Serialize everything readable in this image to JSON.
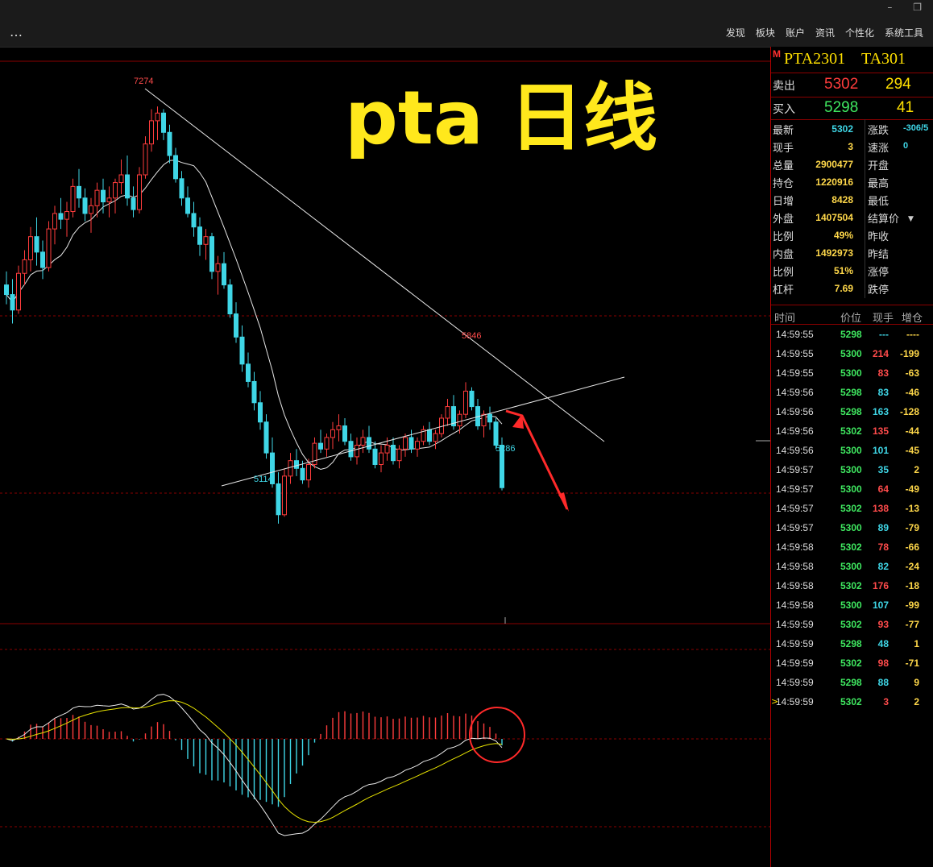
{
  "window": {
    "minimize_glyph": "–",
    "restore_glyph": "❐"
  },
  "toolbar": {
    "more_label": "…",
    "menu": [
      "发现",
      "板块",
      "账户",
      "资讯",
      "个性化",
      "系统工具"
    ]
  },
  "overlay_title": "pta 日线",
  "colors": {
    "up": "#ff3c3c",
    "down": "#3fd6e6",
    "ma": "#e6e6e6",
    "bg": "#000000",
    "grid": "#8a0000",
    "yellow_title": "#ffe81c",
    "arrow": "#ff2a2a"
  },
  "chart_data": {
    "type": "candlestick",
    "annotations": [
      {
        "text": "7274",
        "kind": "high",
        "color": "#ff4b4b"
      },
      {
        "text": "5846",
        "kind": "high",
        "color": "#ff4b4b"
      },
      {
        "text": "5114",
        "kind": "low",
        "color": "#3fd6e6"
      },
      {
        "text": "5286",
        "kind": "low",
        "color": "#3fd6e6"
      }
    ],
    "price_range": [
      4600,
      7500
    ],
    "candles": [
      [
        6350,
        6420,
        6250,
        6300
      ],
      [
        6300,
        6380,
        6150,
        6220
      ],
      [
        6220,
        6450,
        6200,
        6410
      ],
      [
        6410,
        6530,
        6350,
        6480
      ],
      [
        6480,
        6650,
        6420,
        6600
      ],
      [
        6600,
        6700,
        6450,
        6520
      ],
      [
        6520,
        6580,
        6380,
        6440
      ],
      [
        6440,
        6680,
        6420,
        6640
      ],
      [
        6640,
        6760,
        6560,
        6720
      ],
      [
        6720,
        6800,
        6640,
        6690
      ],
      [
        6690,
        6780,
        6600,
        6730
      ],
      [
        6730,
        6900,
        6700,
        6860
      ],
      [
        6860,
        6950,
        6750,
        6800
      ],
      [
        6800,
        6850,
        6680,
        6720
      ],
      [
        6720,
        6800,
        6620,
        6760
      ],
      [
        6760,
        6880,
        6700,
        6840
      ],
      [
        6840,
        6900,
        6720,
        6780
      ],
      [
        6780,
        6860,
        6700,
        6800
      ],
      [
        6800,
        6900,
        6720,
        6880
      ],
      [
        6880,
        7000,
        6820,
        6920
      ],
      [
        6920,
        7020,
        6760,
        6800
      ],
      [
        6800,
        6860,
        6700,
        6740
      ],
      [
        6740,
        6960,
        6720,
        6920
      ],
      [
        6920,
        7120,
        6900,
        7080
      ],
      [
        7080,
        7260,
        7040,
        7200
      ],
      [
        7200,
        7274,
        7100,
        7240
      ],
      [
        7240,
        7260,
        7100,
        7140
      ],
      [
        7140,
        7180,
        6980,
        7020
      ],
      [
        7020,
        7060,
        6880,
        6900
      ],
      [
        6900,
        6940,
        6760,
        6800
      ],
      [
        6800,
        6860,
        6700,
        6720
      ],
      [
        6720,
        6780,
        6600,
        6650
      ],
      [
        6650,
        6700,
        6500,
        6560
      ],
      [
        6560,
        6640,
        6480,
        6600
      ],
      [
        6600,
        6620,
        6380,
        6420
      ],
      [
        6420,
        6500,
        6300,
        6460
      ],
      [
        6460,
        6520,
        6330,
        6350
      ],
      [
        6350,
        6380,
        6180,
        6200
      ],
      [
        6200,
        6260,
        6050,
        6080
      ],
      [
        6080,
        6140,
        5900,
        5940
      ],
      [
        5940,
        6000,
        5820,
        5850
      ],
      [
        5850,
        5900,
        5700,
        5740
      ],
      [
        5740,
        5800,
        5600,
        5640
      ],
      [
        5640,
        5680,
        5450,
        5480
      ],
      [
        5480,
        5560,
        5300,
        5320
      ],
      [
        5320,
        5380,
        5114,
        5160
      ],
      [
        5160,
        5400,
        5150,
        5360
      ],
      [
        5360,
        5480,
        5320,
        5440
      ],
      [
        5440,
        5500,
        5360,
        5400
      ],
      [
        5400,
        5440,
        5320,
        5340
      ],
      [
        5340,
        5450,
        5300,
        5420
      ],
      [
        5420,
        5560,
        5400,
        5530
      ],
      [
        5530,
        5600,
        5480,
        5500
      ],
      [
        5500,
        5580,
        5460,
        5560
      ],
      [
        5560,
        5640,
        5500,
        5600
      ],
      [
        5600,
        5680,
        5540,
        5620
      ],
      [
        5620,
        5660,
        5520,
        5540
      ],
      [
        5540,
        5580,
        5440,
        5460
      ],
      [
        5460,
        5560,
        5420,
        5520
      ],
      [
        5520,
        5600,
        5480,
        5560
      ],
      [
        5560,
        5620,
        5480,
        5500
      ],
      [
        5500,
        5540,
        5400,
        5420
      ],
      [
        5420,
        5520,
        5380,
        5480
      ],
      [
        5480,
        5560,
        5440,
        5520
      ],
      [
        5520,
        5560,
        5420,
        5440
      ],
      [
        5440,
        5520,
        5400,
        5500
      ],
      [
        5500,
        5580,
        5460,
        5560
      ],
      [
        5560,
        5600,
        5480,
        5500
      ],
      [
        5500,
        5560,
        5460,
        5540
      ],
      [
        5540,
        5620,
        5520,
        5600
      ],
      [
        5600,
        5640,
        5520,
        5540
      ],
      [
        5540,
        5600,
        5500,
        5580
      ],
      [
        5580,
        5680,
        5560,
        5660
      ],
      [
        5660,
        5760,
        5620,
        5720
      ],
      [
        5720,
        5780,
        5600,
        5620
      ],
      [
        5620,
        5700,
        5580,
        5680
      ],
      [
        5680,
        5846,
        5660,
        5800
      ],
      [
        5800,
        5820,
        5700,
        5720
      ],
      [
        5720,
        5760,
        5600,
        5620
      ],
      [
        5620,
        5700,
        5560,
        5680
      ],
      [
        5680,
        5720,
        5600,
        5640
      ],
      [
        5640,
        5660,
        5500,
        5520
      ],
      [
        5520,
        5560,
        5286,
        5300
      ]
    ],
    "trendlines": [
      {
        "from": [
          25,
          7274
        ],
        "to": [
          100,
          5300
        ]
      },
      {
        "from": [
          45,
          5030
        ],
        "to": [
          100,
          5580
        ]
      }
    ],
    "macd": {
      "zero": 0,
      "range": [
        -1.0,
        1.0
      ],
      "hist_pos_color": "#ff4b4b",
      "hist_neg_color": "#3fd6e6"
    }
  },
  "panel": {
    "title_mark": "M",
    "symbol": "PTA2301",
    "code": "TA301",
    "ask": {
      "label": "卖出",
      "price": "5302",
      "vol": "294"
    },
    "bid": {
      "label": "买入",
      "price": "5298",
      "vol": "41"
    },
    "stats_left": [
      {
        "k": "最新",
        "v": "5302",
        "c": "#3fd6e6"
      },
      {
        "k": "现手",
        "v": "3",
        "c": "#ffd84a"
      },
      {
        "k": "总量",
        "v": "2900477",
        "c": "#ffd84a"
      },
      {
        "k": "持仓",
        "v": "1220916",
        "c": "#ffd84a"
      },
      {
        "k": "日增",
        "v": "8428",
        "c": "#ffd84a"
      },
      {
        "k": "外盘",
        "v": "1407504",
        "c": "#ffd84a"
      },
      {
        "k": "比例",
        "v": "49%",
        "c": "#ffd84a"
      },
      {
        "k": "内盘",
        "v": "1492973",
        "c": "#ffd84a"
      },
      {
        "k": "比例",
        "v": "51%",
        "c": "#ffd84a"
      },
      {
        "k": "杠杆",
        "v": "7.69",
        "c": "#ffd84a"
      }
    ],
    "stats_right": [
      {
        "k": "涨跌",
        "v": "-306/5"
      },
      {
        "k": "速涨",
        "v": "0"
      },
      {
        "k": "开盘",
        "v": ""
      },
      {
        "k": "最高",
        "v": ""
      },
      {
        "k": "最低",
        "v": ""
      },
      {
        "k": "结算价",
        "v": ""
      },
      {
        "k": "昨收",
        "v": ""
      },
      {
        "k": "昨结",
        "v": ""
      },
      {
        "k": "涨停",
        "v": ""
      },
      {
        "k": "跌停",
        "v": ""
      }
    ],
    "tick_headers": [
      "时间",
      "价位",
      "现手",
      "增仓"
    ],
    "ticks": [
      {
        "t": "14:59:55",
        "p": "5298",
        "v": "---",
        "oi": "----",
        "vc": "#3fd6e6",
        "oic": "#ffd84a"
      },
      {
        "t": "14:59:55",
        "p": "5300",
        "v": "214",
        "oi": "-199",
        "vc": "#ff4b4b",
        "oic": "#ffd84a"
      },
      {
        "t": "14:59:55",
        "p": "5300",
        "v": "83",
        "oi": "-63",
        "vc": "#ff4b4b",
        "oic": "#ffd84a"
      },
      {
        "t": "14:59:56",
        "p": "5298",
        "v": "83",
        "oi": "-46",
        "vc": "#3fd6e6",
        "oic": "#ffd84a"
      },
      {
        "t": "14:59:56",
        "p": "5298",
        "v": "163",
        "oi": "-128",
        "vc": "#3fd6e6",
        "oic": "#ffd84a"
      },
      {
        "t": "14:59:56",
        "p": "5302",
        "v": "135",
        "oi": "-44",
        "vc": "#ff4b4b",
        "oic": "#ffd84a"
      },
      {
        "t": "14:59:56",
        "p": "5300",
        "v": "101",
        "oi": "-45",
        "vc": "#3fd6e6",
        "oic": "#ffd84a"
      },
      {
        "t": "14:59:57",
        "p": "5300",
        "v": "35",
        "oi": "2",
        "vc": "#3fd6e6",
        "oic": "#ffd84a"
      },
      {
        "t": "14:59:57",
        "p": "5300",
        "v": "64",
        "oi": "-49",
        "vc": "#ff4b4b",
        "oic": "#ffd84a"
      },
      {
        "t": "14:59:57",
        "p": "5302",
        "v": "138",
        "oi": "-13",
        "vc": "#ff4b4b",
        "oic": "#ffd84a"
      },
      {
        "t": "14:59:57",
        "p": "5300",
        "v": "89",
        "oi": "-79",
        "vc": "#3fd6e6",
        "oic": "#ffd84a"
      },
      {
        "t": "14:59:58",
        "p": "5302",
        "v": "78",
        "oi": "-66",
        "vc": "#ff4b4b",
        "oic": "#ffd84a"
      },
      {
        "t": "14:59:58",
        "p": "5300",
        "v": "82",
        "oi": "-24",
        "vc": "#3fd6e6",
        "oic": "#ffd84a"
      },
      {
        "t": "14:59:58",
        "p": "5302",
        "v": "176",
        "oi": "-18",
        "vc": "#ff4b4b",
        "oic": "#ffd84a"
      },
      {
        "t": "14:59:58",
        "p": "5300",
        "v": "107",
        "oi": "-99",
        "vc": "#3fd6e6",
        "oic": "#ffd84a"
      },
      {
        "t": "14:59:59",
        "p": "5302",
        "v": "93",
        "oi": "-77",
        "vc": "#ff4b4b",
        "oic": "#ffd84a"
      },
      {
        "t": "14:59:59",
        "p": "5298",
        "v": "48",
        "oi": "1",
        "vc": "#3fd6e6",
        "oic": "#ffd84a"
      },
      {
        "t": "14:59:59",
        "p": "5302",
        "v": "98",
        "oi": "-71",
        "vc": "#ff4b4b",
        "oic": "#ffd84a"
      },
      {
        "t": "14:59:59",
        "p": "5298",
        "v": "88",
        "oi": "9",
        "vc": "#3fd6e6",
        "oic": "#ffd84a"
      },
      {
        "t": "14:59:59",
        "p": "5302",
        "v": "3",
        "oi": "2",
        "vc": "#ff4b4b",
        "oic": "#ffd84a"
      }
    ]
  }
}
